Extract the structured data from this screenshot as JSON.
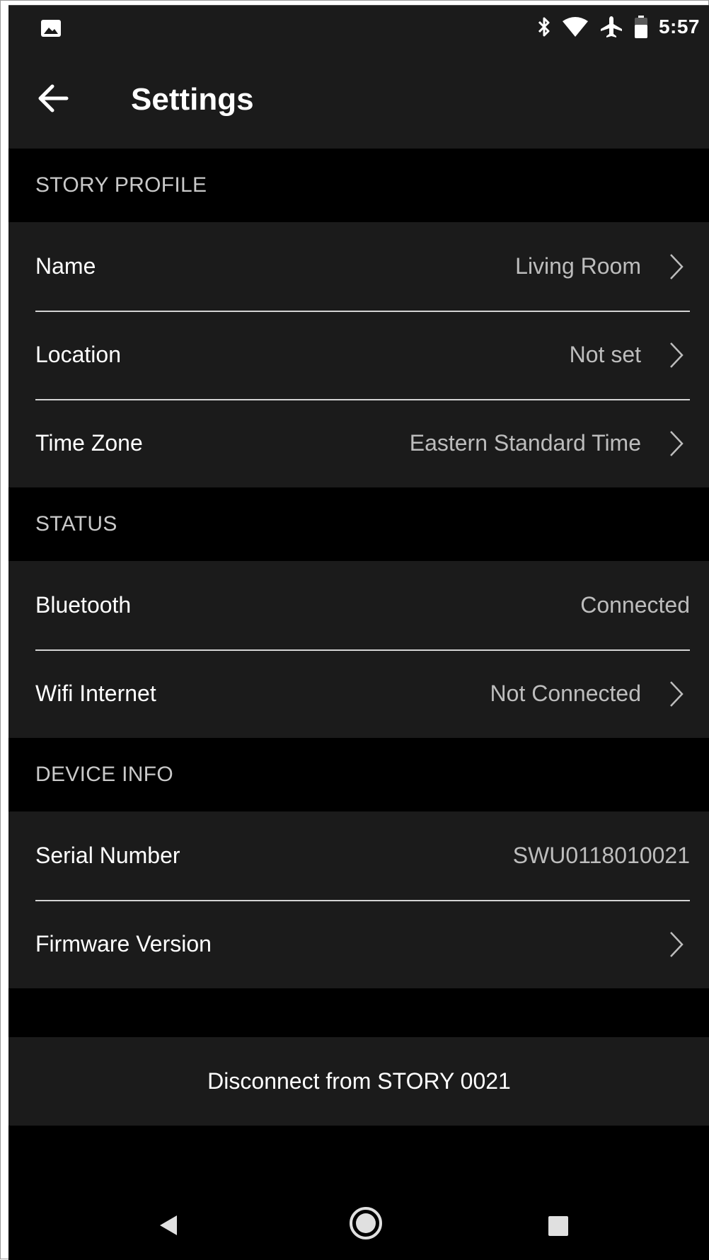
{
  "status_bar": {
    "time": "5:57",
    "icons": [
      "image-icon",
      "bluetooth-icon",
      "wifi-icon",
      "airplane-icon",
      "battery-icon"
    ]
  },
  "app_bar": {
    "title": "Settings",
    "back_icon": "arrow-left-icon"
  },
  "sections": {
    "story_profile": {
      "header": "STORY PROFILE",
      "rows": [
        {
          "label": "Name",
          "value": "Living Room"
        },
        {
          "label": "Location",
          "value": "Not set"
        },
        {
          "label": "Time Zone",
          "value": "Eastern Standard Time"
        }
      ]
    },
    "status": {
      "header": "STATUS",
      "rows": [
        {
          "label": "Bluetooth",
          "value": "Connected"
        },
        {
          "label": "Wifi Internet",
          "value": "Not Connected"
        }
      ]
    },
    "device_info": {
      "header": "DEVICE INFO",
      "rows": [
        {
          "label": "Serial Number",
          "value": "SWU0118010021"
        },
        {
          "label": "Firmware Version",
          "value": ""
        }
      ]
    }
  },
  "disconnect_button": "Disconnect from STORY 0021",
  "nav_bar": {
    "icons": [
      "nav-back-icon",
      "nav-home-icon",
      "nav-recents-icon"
    ]
  },
  "colors": {
    "background": "#000000",
    "surface": "#1b1b1b",
    "text_primary": "#ffffff",
    "text_secondary": "#bdbdbd",
    "divider": "#d4d4d4"
  }
}
